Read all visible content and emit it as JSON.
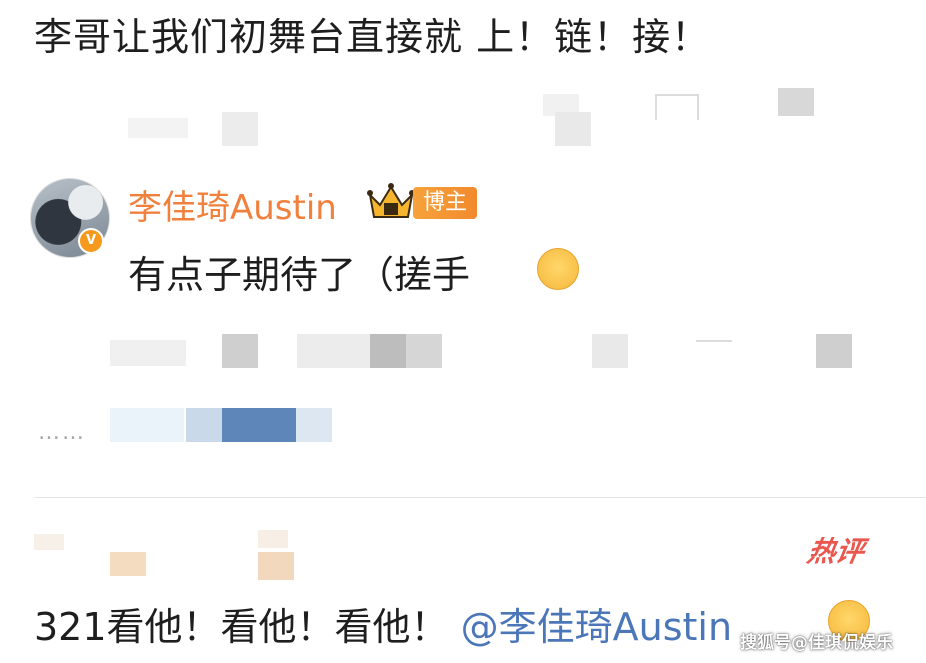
{
  "top_comment": {
    "text": "李哥让我们初舞台直接就 上！链！接！"
  },
  "reply": {
    "author_name": "李佳琦Austin",
    "author_badge": "博主",
    "verified_mark": "V",
    "text": "有点子期待了（搓手",
    "emoji_icon": "rubbing-hands-emoji"
  },
  "more_indicator": "……",
  "hot_comment": {
    "hot_label": "热评",
    "text": "321看他！看他！看他！",
    "mention": "@李佳琦Austin",
    "emoji_icon": "heart-eyes-emoji"
  },
  "watermark": "搜狐号@佳琪侃娱乐",
  "colors": {
    "name_orange": "#f0803c",
    "badge_orange": "#f18a2d",
    "mention_blue": "#4b77b8",
    "hot_red": "#e9574f"
  }
}
